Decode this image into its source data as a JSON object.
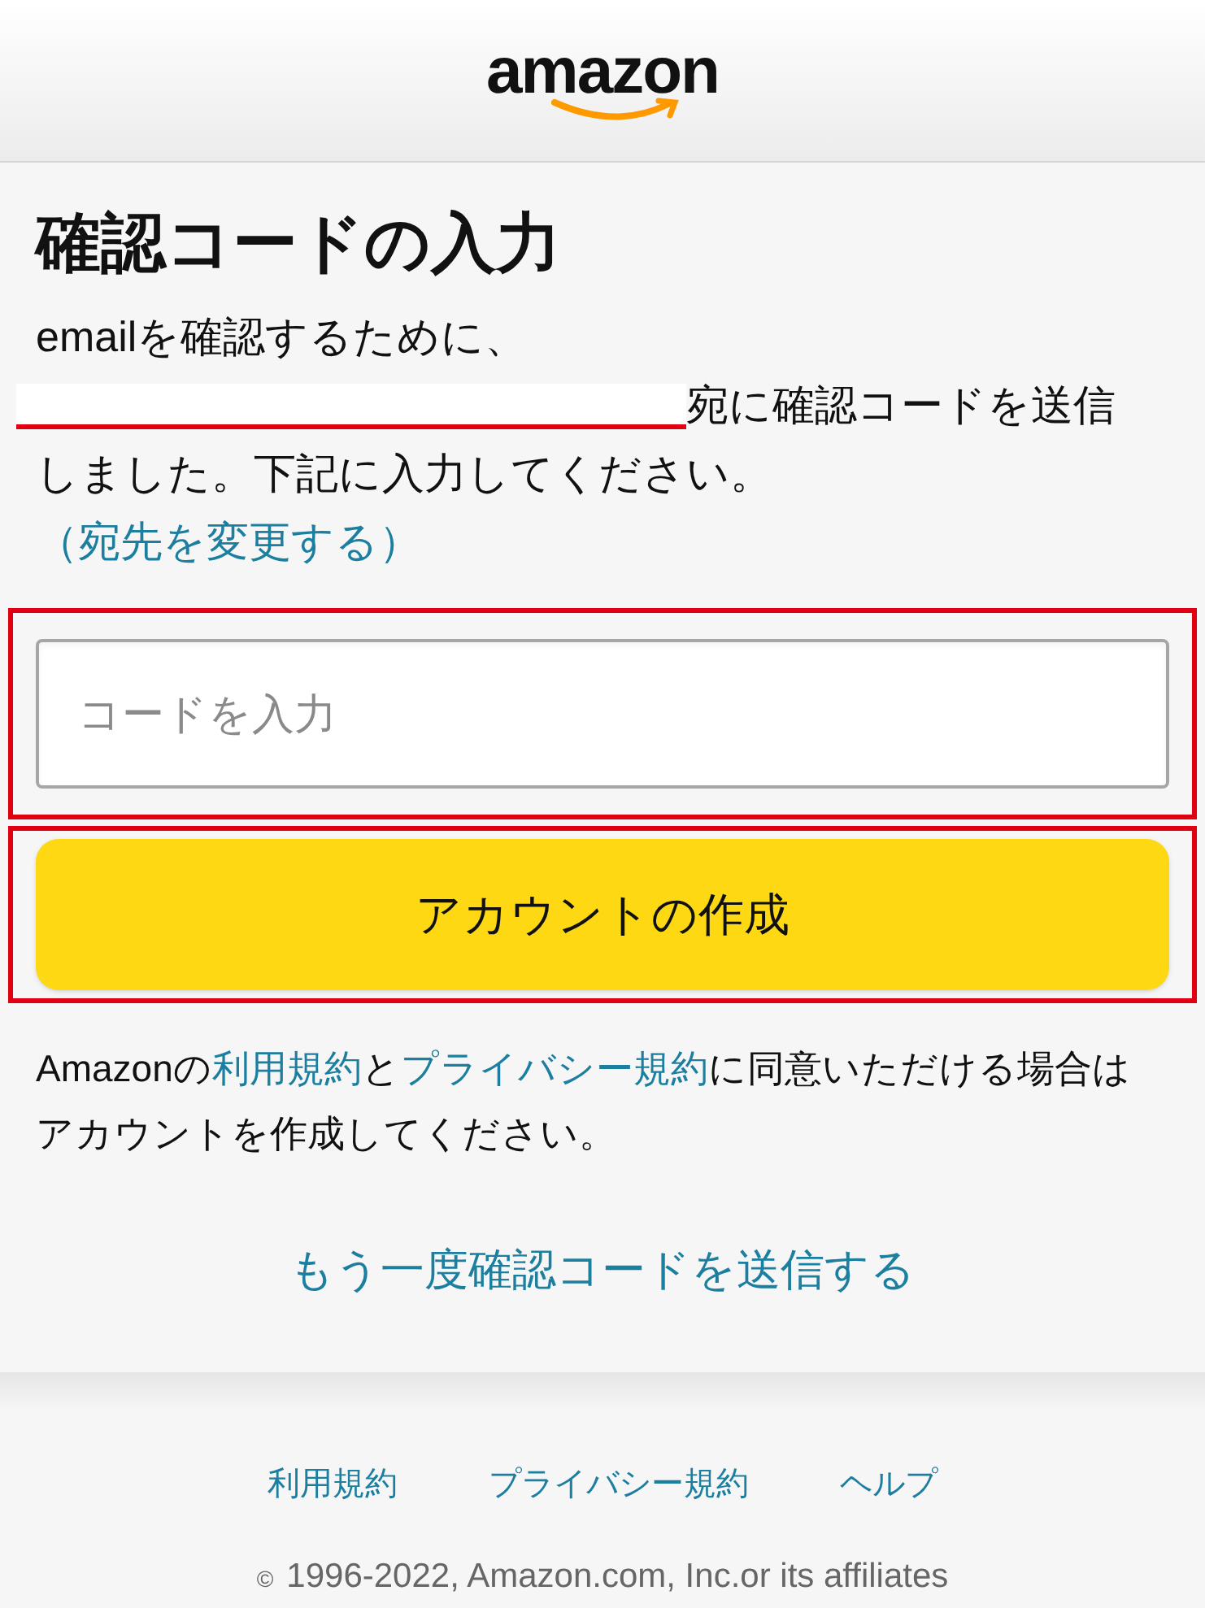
{
  "header": {
    "logo": "amazon"
  },
  "title": "確認コードの入力",
  "message": {
    "before": "emailを確認するために、",
    "after": "宛に確認コードを送信しました。下記に入力してください。",
    "change_link": "（宛先を変更する）"
  },
  "code_field": {
    "placeholder": "コードを入力"
  },
  "create_button": "アカウントの作成",
  "legal": {
    "parts": [
      {
        "kind": "text",
        "text": "Amazonの"
      },
      {
        "kind": "link",
        "text": "利用規約"
      },
      {
        "kind": "text",
        "text": "と"
      },
      {
        "kind": "link",
        "text": "プライバシー規約"
      },
      {
        "kind": "text",
        "text": "に同意いただける場合はアカウントを作成してください。"
      }
    ]
  },
  "resend_link": "もう一度確認コードを送信する",
  "footer": {
    "links": [
      "利用規約",
      "プライバシー規約",
      "ヘルプ"
    ],
    "copyright": "1996-2022, Amazon.com, Inc.or its affiliates",
    "copyright_mark": "©"
  }
}
